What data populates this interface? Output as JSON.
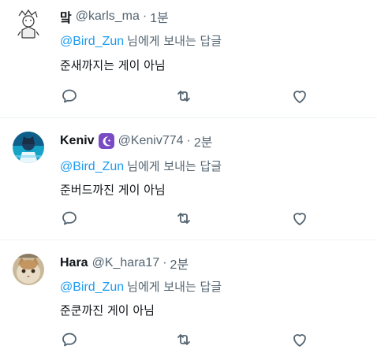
{
  "tweets": [
    {
      "name": "맠",
      "handle": "@karls_ma",
      "dot": "·",
      "time": "1분",
      "reply_to": "@Bird_Zun",
      "reply_suffix": "님에게 보내는 답글",
      "text": "준새까지는 게이 아님",
      "verified_badge": false
    },
    {
      "name": "Keniv",
      "handle": "@Keniv774",
      "dot": "·",
      "time": "2분",
      "reply_to": "@Bird_Zun",
      "reply_suffix": "님에게 보내는 답글",
      "text": "준버드까진 게이 아님",
      "verified_badge": true
    },
    {
      "name": "Hara",
      "handle": "@K_hara17",
      "dot": "·",
      "time": "2분",
      "reply_to": "@Bird_Zun",
      "reply_suffix": "님에게 보내는 답글",
      "text": "준쿤까진 게이 아님",
      "verified_badge": false
    }
  ],
  "colors": {
    "accent": "#1d9bf0",
    "secondary_text": "#536471",
    "primary_text": "#0f1419",
    "badge": "#794bc4",
    "divider": "#eff3f4"
  },
  "icons": {
    "reply": "reply-icon",
    "retweet": "retweet-icon",
    "like": "like-icon",
    "badge": "moon-star-badge-icon"
  }
}
